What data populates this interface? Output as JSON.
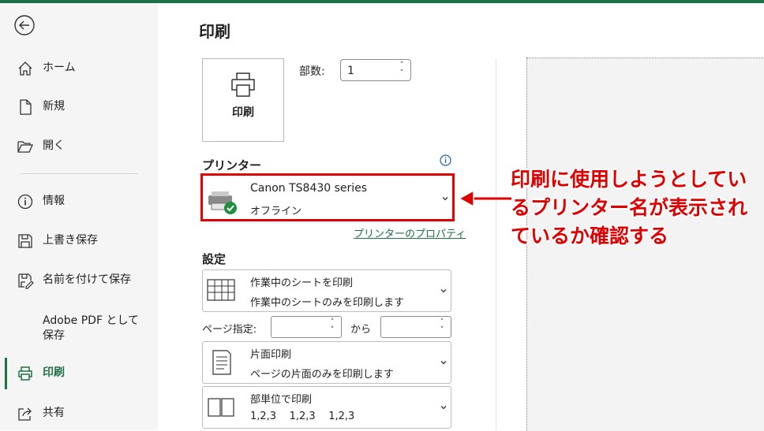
{
  "page": {
    "title": "印刷"
  },
  "sidebar": {
    "items": [
      {
        "label": "ホーム"
      },
      {
        "label": "新規"
      },
      {
        "label": "開く"
      },
      {
        "label": "情報"
      },
      {
        "label": "上書き保存"
      },
      {
        "label": "名前を付けて保存"
      },
      {
        "label": "Adobe PDF として\n保存"
      },
      {
        "label": "印刷"
      },
      {
        "label": "共有"
      }
    ]
  },
  "print_button": {
    "label": "印刷"
  },
  "copies": {
    "label": "部数:",
    "value": "1"
  },
  "printer": {
    "heading": "プリンター",
    "name": "Canon TS8430 series",
    "status": "オフライン",
    "properties_link": "プリンターのプロパティ"
  },
  "settings": {
    "heading": "設定",
    "scope": {
      "line1": "作業中のシートを印刷",
      "line2": "作業中のシートのみを印刷します"
    },
    "pages_label": "ページ指定:",
    "from_label": "から",
    "sides": {
      "line1": "片面印刷",
      "line2": "ページの片面のみを印刷します"
    },
    "collate": {
      "line1": "部単位で印刷",
      "line2": "1,2,3    1,2,3    1,2,3"
    }
  },
  "annotation": {
    "text": "印刷に使用しようとしているプリンター名が表示されているか確認する"
  },
  "colors": {
    "accent": "#1e7145",
    "annotation_red": "#e00000"
  }
}
